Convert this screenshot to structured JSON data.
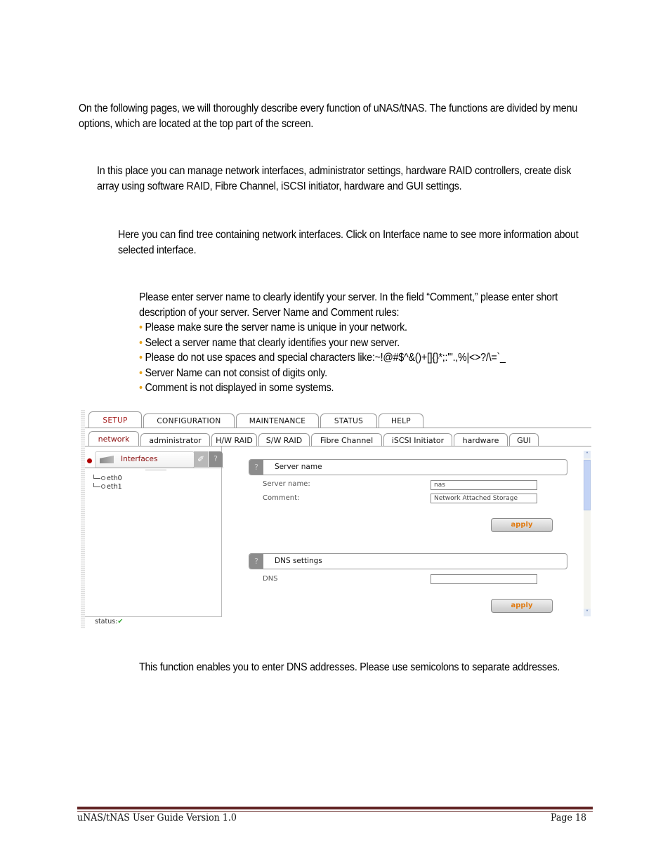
{
  "paragraphs": {
    "intro": "On the following pages, we will thoroughly describe every function of uNAS/tNAS. The functions are divided by menu options, which are located at the top part of the screen.",
    "setup": "In this place you can manage network interfaces, administrator settings, hardware RAID controllers, create disk array using software RAID, Fibre Channel, iSCSI initiator, hardware and GUI settings.",
    "network": "Here you can find tree containing network interfaces. Click on Interface name to see more information about selected interface.",
    "server_name": "Please enter server name to clearly identify your server. In the field “Comment,” please enter short description of your server. Server Name and Comment rules:",
    "dns": "This function enables you to enter DNS addresses. Please use semicolons to separate addresses."
  },
  "rules": {
    "bullet": "•",
    "items": [
      "Please make sure the server name is unique in your network.",
      "Select a server name that clearly identifies your new server.",
      "Please do not use spaces and special characters like:~!@#$^&()+[]{}*;:'\".,%|<>?/\\=`_",
      "Server Name can not consist of digits only.",
      "Comment is not displayed in some systems."
    ]
  },
  "screenshot": {
    "main_tabs": [
      {
        "label": "SETUP",
        "active": true
      },
      {
        "label": "CONFIGURATION",
        "active": false
      },
      {
        "label": "MAINTENANCE",
        "active": false
      },
      {
        "label": "STATUS",
        "active": false
      },
      {
        "label": "HELP",
        "active": false
      }
    ],
    "sub_tabs": [
      {
        "label": "network",
        "active": true
      },
      {
        "label": "administrator",
        "active": false
      },
      {
        "label": "H/W RAID",
        "active": false
      },
      {
        "label": "S/W RAID",
        "active": false
      },
      {
        "label": "Fibre Channel",
        "active": false
      },
      {
        "label": "iSCSI Initiator",
        "active": false
      },
      {
        "label": "hardware",
        "active": false
      },
      {
        "label": "GUI",
        "active": false
      }
    ],
    "tree": {
      "title": "Interfaces",
      "tool_icon": "✐",
      "help_icon": "?",
      "items": [
        "eth0",
        "eth1"
      ]
    },
    "status_label": "status:",
    "status_icon": "✔",
    "server_section": {
      "help": "?",
      "title": "Server name",
      "server_name_label": "Server name:",
      "server_name_value": "nas",
      "comment_label": "Comment:",
      "comment_value": "Network Attached Storage",
      "apply": "apply"
    },
    "dns_section": {
      "help": "?",
      "title": "DNS settings",
      "dns_label": "DNS",
      "dns_value": "",
      "apply": "apply"
    },
    "scroll_up": "˄",
    "scroll_down": "˅"
  },
  "footer": {
    "left": "uNAS/tNAS User Guide Version 1.0",
    "right": "Page 18"
  }
}
